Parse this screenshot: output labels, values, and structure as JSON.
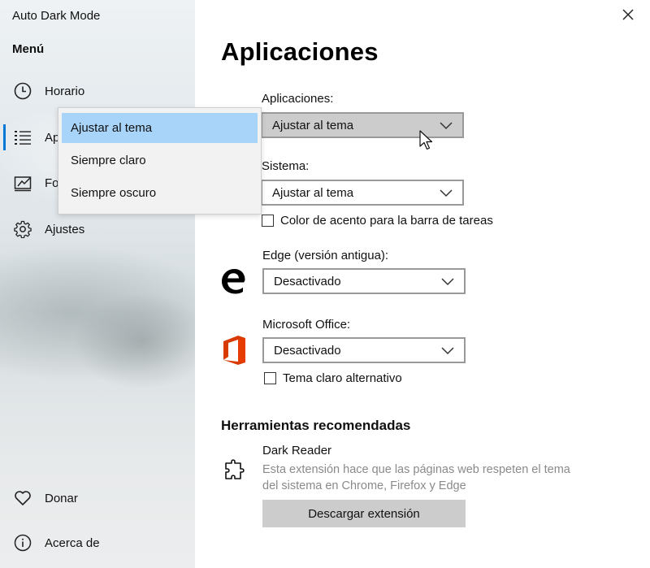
{
  "app": {
    "title": "Auto Dark Mode"
  },
  "sidebar": {
    "menu_heading": "Menú",
    "items": [
      {
        "label": "Horario",
        "icon": "clock-icon"
      },
      {
        "label": "Ap",
        "icon": "list-icon"
      },
      {
        "label": "Fo",
        "icon": "wallpaper-icon"
      },
      {
        "label": "Ajustes",
        "icon": "gear-icon"
      },
      {
        "label": "Donar",
        "icon": "heart-icon"
      },
      {
        "label": "Acerca de",
        "icon": "info-icon"
      }
    ]
  },
  "flyout": {
    "options": [
      "Ajustar al tema",
      "Siempre claro",
      "Siempre oscuro"
    ],
    "selected_index": 0
  },
  "main": {
    "title": "Aplicaciones",
    "apps": {
      "label": "Aplicaciones:",
      "value": "Ajustar al tema"
    },
    "system": {
      "label": "Sistema:",
      "value": "Ajustar al tema",
      "checkbox_label": "Color de acento para la barra de tareas",
      "checked": false
    },
    "edge": {
      "label": "Edge (versión antigua):",
      "value": "Desactivado",
      "icon": "edge-icon"
    },
    "office": {
      "label": "Microsoft Office:",
      "value": "Desactivado",
      "icon": "office-icon",
      "checkbox_label": "Tema claro alternativo",
      "checked": false
    },
    "tools": {
      "title": "Herramientas recomendadas",
      "name": "Dark Reader",
      "icon": "puzzle-icon",
      "description": "Esta extensión hace que las páginas web respeten el tema del sistema en Chrome, Firefox y Edge",
      "button_label": "Descargar extensión"
    }
  },
  "colors": {
    "accent": "#0078d7",
    "selection": "#a8d4fa",
    "office_red": "#d83b01"
  }
}
